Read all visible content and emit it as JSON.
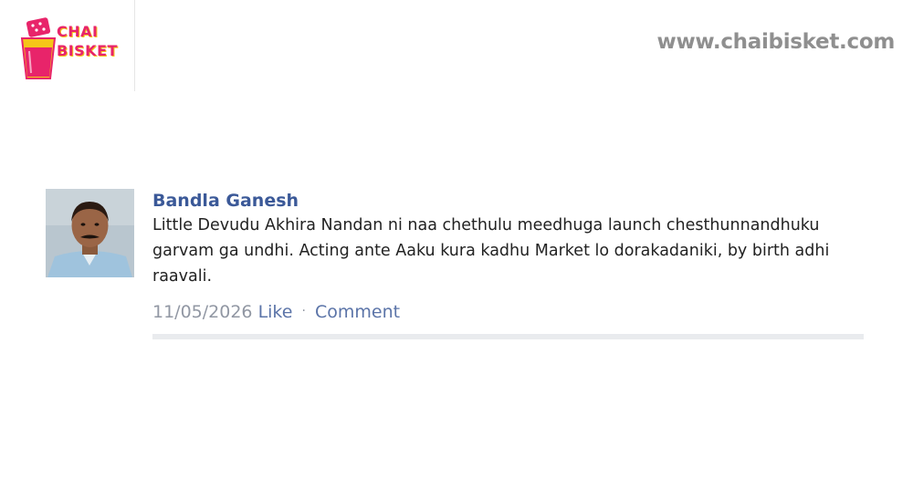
{
  "brand": {
    "logo_line1": "CHAI",
    "logo_line2": "BISKET",
    "site_url": "www.chaibisket.com"
  },
  "post": {
    "author": "Bandla Ganesh",
    "text": "Little Devudu Akhira Nandan ni naa chethulu meedhuga launch chesthunnandhuku garvam ga undhi. Acting ante Aaku kura kadhu Market lo dorakadaniki, by birth adhi raavali.",
    "date": "11/05/2026",
    "like_label": "Like",
    "separator": "·",
    "comment_label": "Comment"
  },
  "colors": {
    "author_link": "#3b5998",
    "action_link": "#5b74a8",
    "meta_gray": "#9197a3",
    "brand_pink": "#e8246a",
    "brand_yellow": "#f5c518"
  }
}
